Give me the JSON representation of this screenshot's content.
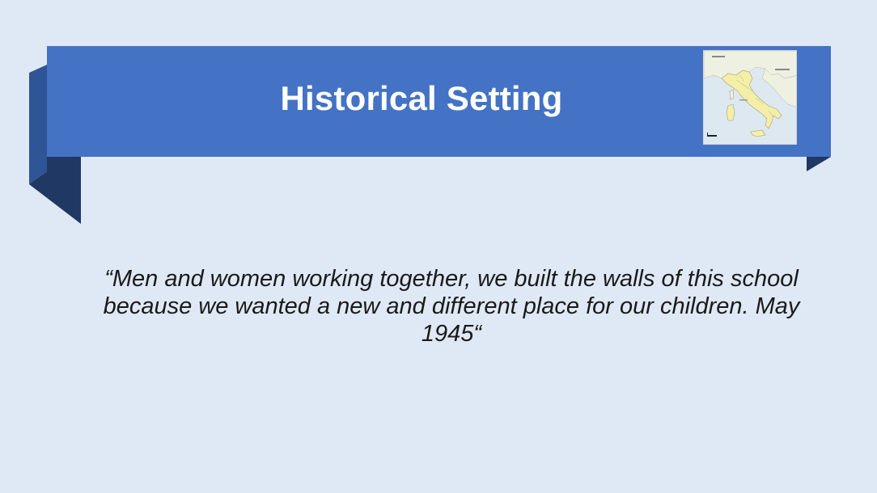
{
  "slide": {
    "title": "Historical Setting",
    "quote": "“Men and women working together, we built the walls of this school because we wanted a new and different place for our children. May 1945“"
  },
  "image": {
    "icon": "italy-map-icon",
    "caption": "Map of Italy"
  },
  "colors": {
    "background": "#dfe9f5",
    "ribbon_front": "#4472c4",
    "ribbon_back": "#2f5597",
    "ribbon_fold": "#1f3864",
    "text": "#1a1a1a"
  }
}
